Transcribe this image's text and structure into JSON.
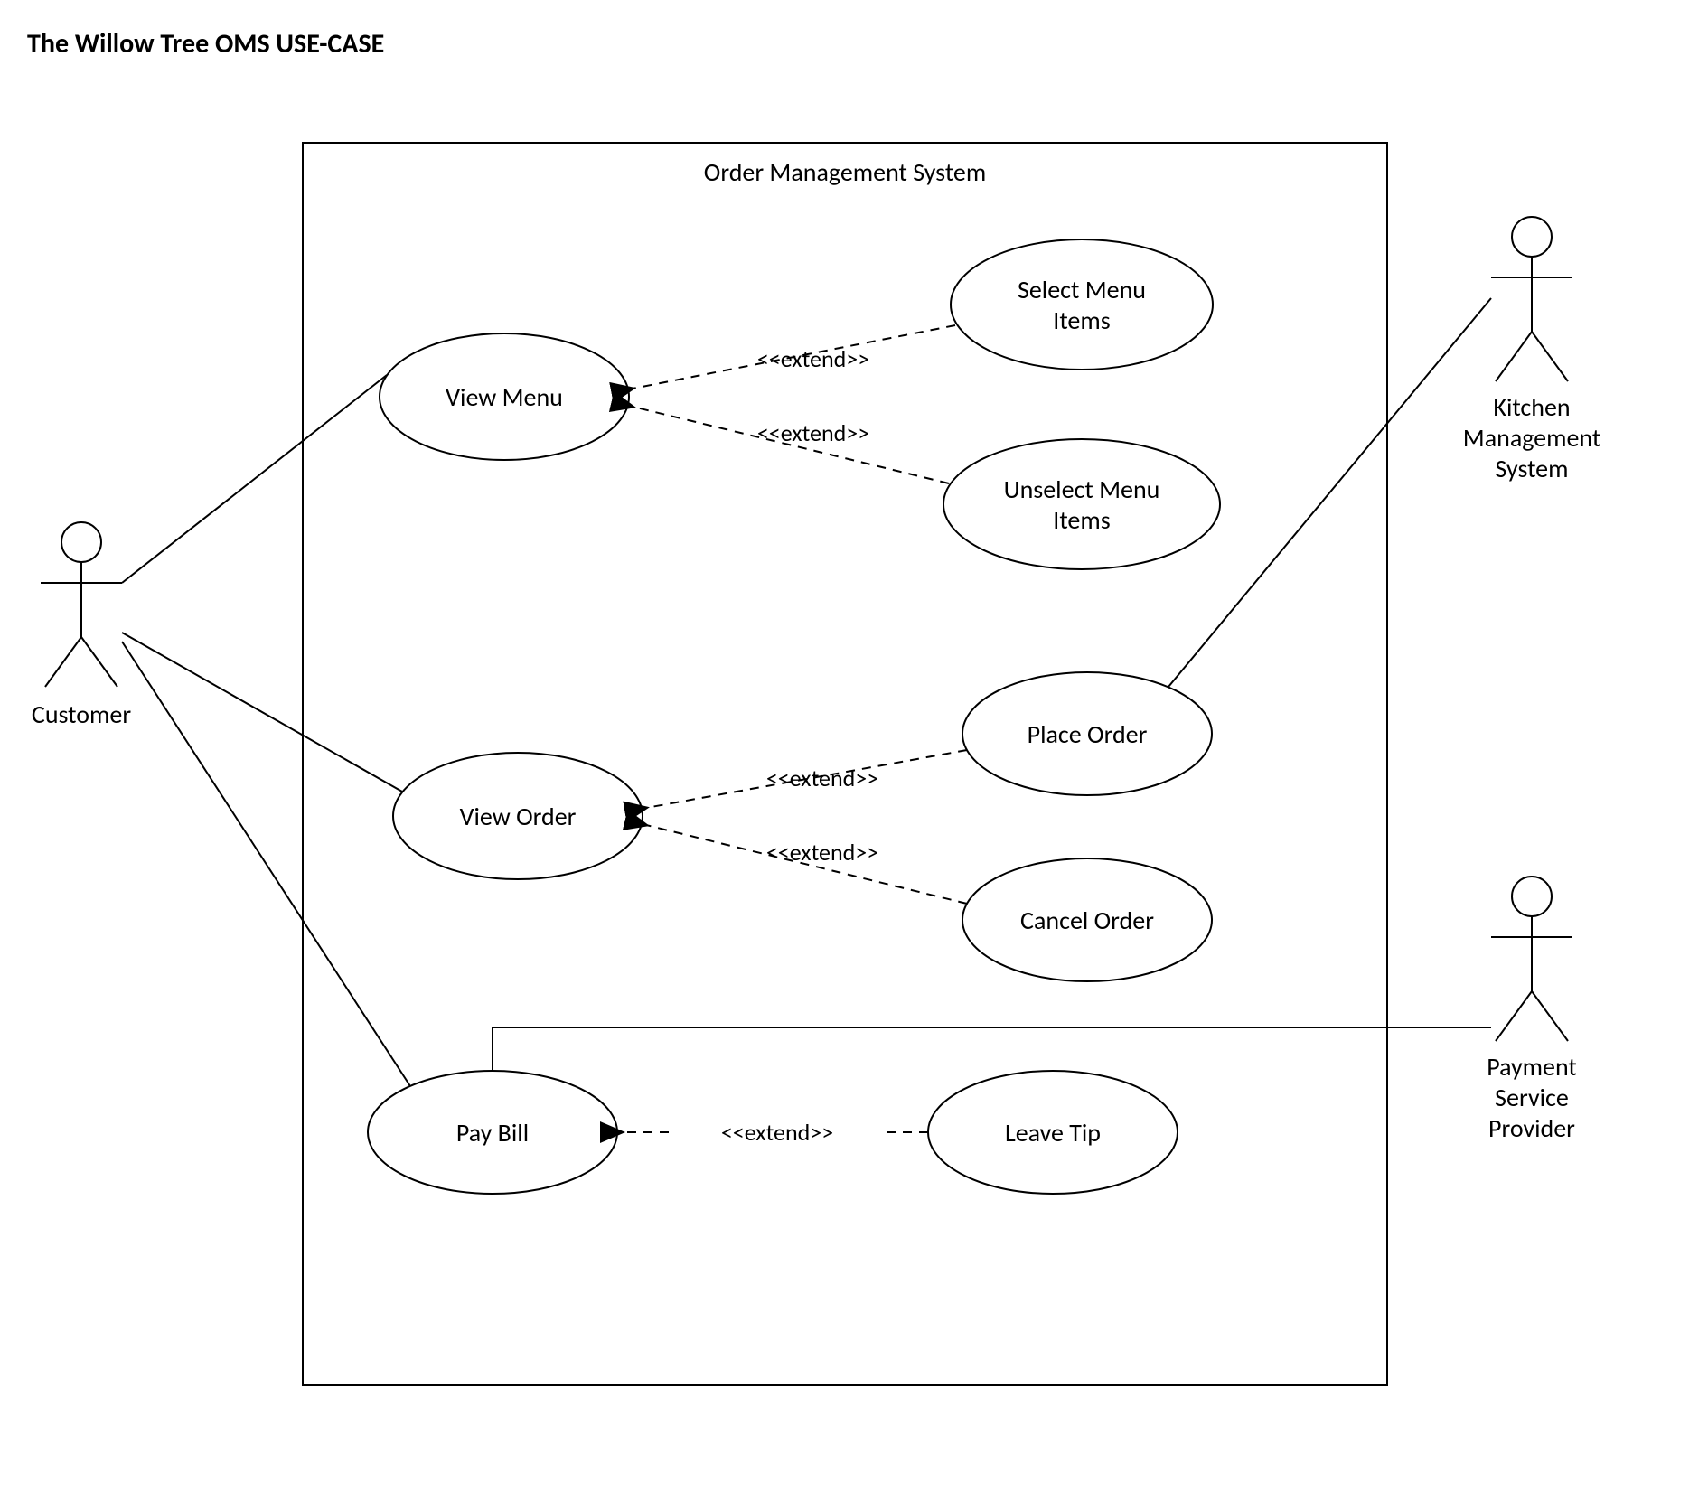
{
  "title": "The Willow Tree OMS USE-CASE",
  "system_name": "Order Management System",
  "actors": {
    "customer": "Customer",
    "kms": {
      "l1": "Kitchen",
      "l2": "Management",
      "l3": "System"
    },
    "psp": {
      "l1": "Payment",
      "l2": "Service",
      "l3": "Provider"
    }
  },
  "usecases": {
    "view_menu": "View Menu",
    "select_menu": {
      "l1": "Select Menu",
      "l2": "Items"
    },
    "unselect_menu": {
      "l1": "Unselect Menu",
      "l2": "Items"
    },
    "view_order": "View Order",
    "place_order": "Place Order",
    "cancel_order": "Cancel Order",
    "pay_bill": "Pay Bill",
    "leave_tip": "Leave Tip"
  },
  "extend": "<<extend>>"
}
